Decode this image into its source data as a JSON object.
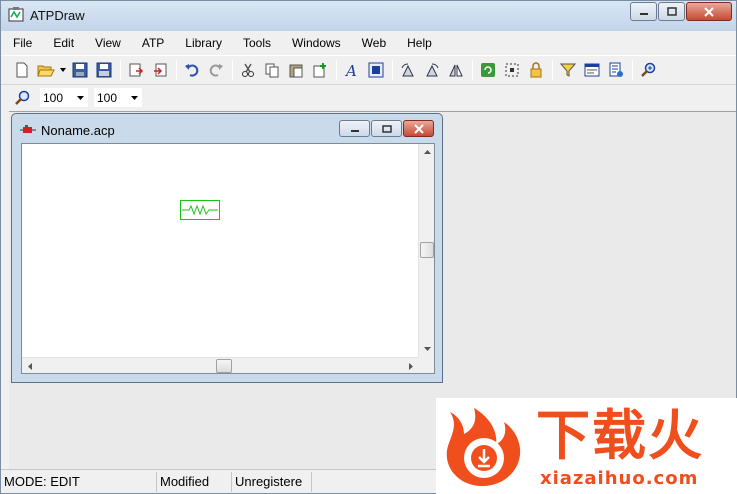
{
  "app": {
    "title": "ATPDraw"
  },
  "menu": [
    "File",
    "Edit",
    "View",
    "ATP",
    "Library",
    "Tools",
    "Windows",
    "Web",
    "Help"
  ],
  "toolbar": {
    "icons": [
      "new-file-icon",
      "open-folder-icon",
      "save-icon",
      "save-all-icon",
      "import-icon",
      "export-icon",
      "undo-icon",
      "redo-icon",
      "cut-icon",
      "copy-icon",
      "paste-icon",
      "duplicate-icon",
      "text-icon",
      "image-icon",
      "rotate-left-icon",
      "rotate-right-icon",
      "flip-icon",
      "refresh-icon",
      "select-all-icon",
      "lock-icon",
      "filter-icon",
      "comment-icon",
      "settings-icon",
      "zoom-in-icon"
    ]
  },
  "zoom": {
    "value1": "100",
    "value2": "100"
  },
  "child_window": {
    "title": "Noname.acp"
  },
  "status": {
    "mode": "MODE: EDIT",
    "modified": "Modified",
    "registration": "Unregistere"
  },
  "watermark": {
    "cn": "下载火",
    "en": "xiazaihuo.com"
  },
  "colors": {
    "accent": "#f04e1c",
    "resistor": "#18c318",
    "close_button": "#c74a33"
  }
}
